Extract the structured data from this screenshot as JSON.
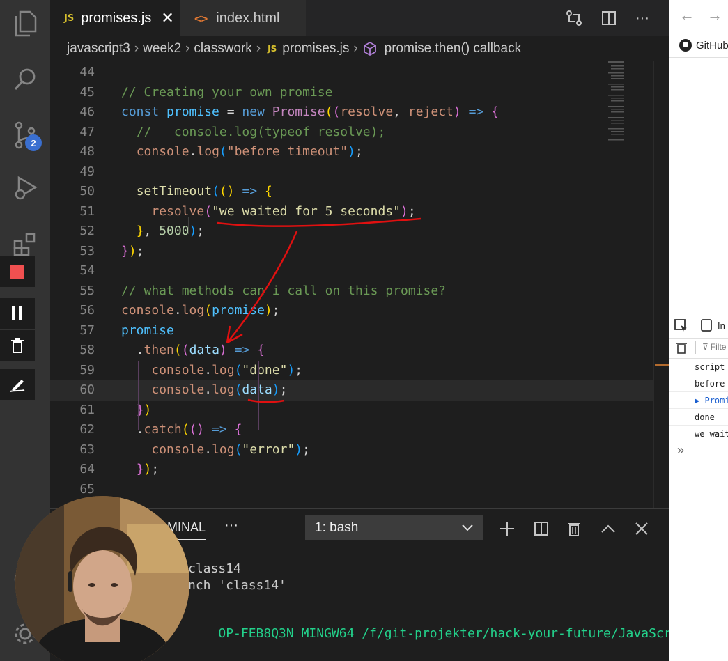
{
  "tabs": [
    {
      "icon": "JS",
      "label": "promises.js",
      "active": true
    },
    {
      "icon": "<>",
      "label": "index.html",
      "active": false
    }
  ],
  "breadcrumb": {
    "parts": [
      "javascript3",
      "week2",
      "classwork"
    ],
    "file_icon": "JS",
    "file": "promises.js",
    "symbol": "promise.then() callback"
  },
  "activity_bar": {
    "icons": [
      "files-icon",
      "search-icon",
      "source-control-icon",
      "run-debug-icon",
      "extensions-icon",
      "account-icon",
      "settings-gear-icon"
    ],
    "scm_badge": "2"
  },
  "editor": {
    "lines": [
      {
        "n": "44",
        "html": ""
      },
      {
        "n": "45",
        "html": "<span class='c-cmt'>// Creating your own promise</span>"
      },
      {
        "n": "46",
        "html": "<span class='c-kw'>const</span> <span class='c-var'>promise</span> = <span class='c-kw'>new</span> <span class='c-kw2'>Promise</span><span class='b1'>(</span><span class='b2'>(</span><span class='c-str'>resolve</span>, <span class='c-str'>reject</span><span class='b2'>)</span> <span class='c-kw'>=&gt;</span> <span class='b2'>{</span>"
      },
      {
        "n": "47",
        "html": "  <span class='c-cmt'>//   console.log(typeof resolve);</span>"
      },
      {
        "n": "48",
        "html": "  <span class='c-str'>console</span>.<span class='c-str'>log</span><span class='b3'>(</span><span class='c-str'>\"before timeout\"</span><span class='b3'>)</span>;"
      },
      {
        "n": "49",
        "html": ""
      },
      {
        "n": "50",
        "html": "  <span class='c-fn'>setTimeout</span><span class='b3'>(</span><span class='b1'>()</span> <span class='c-kw'>=&gt;</span> <span class='b1'>{</span>"
      },
      {
        "n": "51",
        "html": "    <span class='c-str'>resolve</span><span class='b2'>(</span><span class='c-fn'>\"we waited for 5 seconds\"</span><span class='b2'>)</span>;"
      },
      {
        "n": "52",
        "html": "  <span class='b1'>}</span>, <span class='c-num'>5000</span><span class='b3'>)</span>;"
      },
      {
        "n": "53",
        "html": "<span class='b2'>}</span><span class='b1'>)</span>;"
      },
      {
        "n": "54",
        "html": ""
      },
      {
        "n": "55",
        "html": "<span class='c-cmt'>// what methods can i call on this promise?</span>"
      },
      {
        "n": "56",
        "html": "<span class='c-str'>console</span>.<span class='c-str'>log</span><span class='b1'>(</span><span class='c-var'>promise</span><span class='b1'>)</span>;"
      },
      {
        "n": "57",
        "html": "<span class='c-var'>promise</span>"
      },
      {
        "n": "58",
        "html": "  .<span class='c-str'>then</span><span class='b1'>(</span><span class='b2'>(</span><span class='c-par'>data</span><span class='b2'>)</span> <span class='c-kw'>=&gt;</span> <span class='b2'>{</span>"
      },
      {
        "n": "59",
        "html": "    <span class='c-str'>console</span>.<span class='c-str'>log</span><span class='b3'>(</span><span class='c-fn'>\"done\"</span><span class='b3'>)</span>;"
      },
      {
        "n": "60",
        "html": "    <span class='c-str'>console</span>.<span class='c-str'>log</span><span class='b3'>(</span><span class='c-par'>data</span><span class='b3'>)</span>;"
      },
      {
        "n": "61",
        "html": "  <span class='b2'>}</span><span class='b1'>)</span>"
      },
      {
        "n": "62",
        "html": "  .<span class='c-str'>catch</span><span class='b1'>(</span><span class='b2'>()</span> <span class='c-kw'>=&gt;</span> <span class='b2'>{</span>"
      },
      {
        "n": "63",
        "html": "    <span class='c-str'>console</span>.<span class='c-str'>log</span><span class='b3'>(</span><span class='c-fn'>\"error\"</span><span class='b3'>)</span>;"
      },
      {
        "n": "64",
        "html": "  <span class='b2'>}</span><span class='b1'>)</span>;"
      },
      {
        "n": "65",
        "html": ""
      }
    ]
  },
  "panel": {
    "tab_label": "MINAL",
    "more": "···",
    "terminal_select": "1: bash",
    "lines": [
      {
        "text": "class14",
        "color": "#cccccc"
      },
      {
        "text": "nch 'class14'",
        "color": "#cccccc"
      },
      {
        "text": "",
        "color": "#cccccc"
      },
      {
        "text": "OP-FEB8Q3N MINGW64 /f/git-projekter/hack-your-future/JavaScri",
        "color": "#23d18b"
      }
    ]
  },
  "browser": {
    "github_label": "GitHub",
    "devtools_tabs": [
      "In",
      "Filte"
    ],
    "console": [
      "script",
      "before",
      "▶ Promi",
      "done",
      "we wait"
    ],
    "prompt": "»"
  },
  "colors": {
    "annotation": "#e01010",
    "accent_badge": "#3a6fd0"
  }
}
